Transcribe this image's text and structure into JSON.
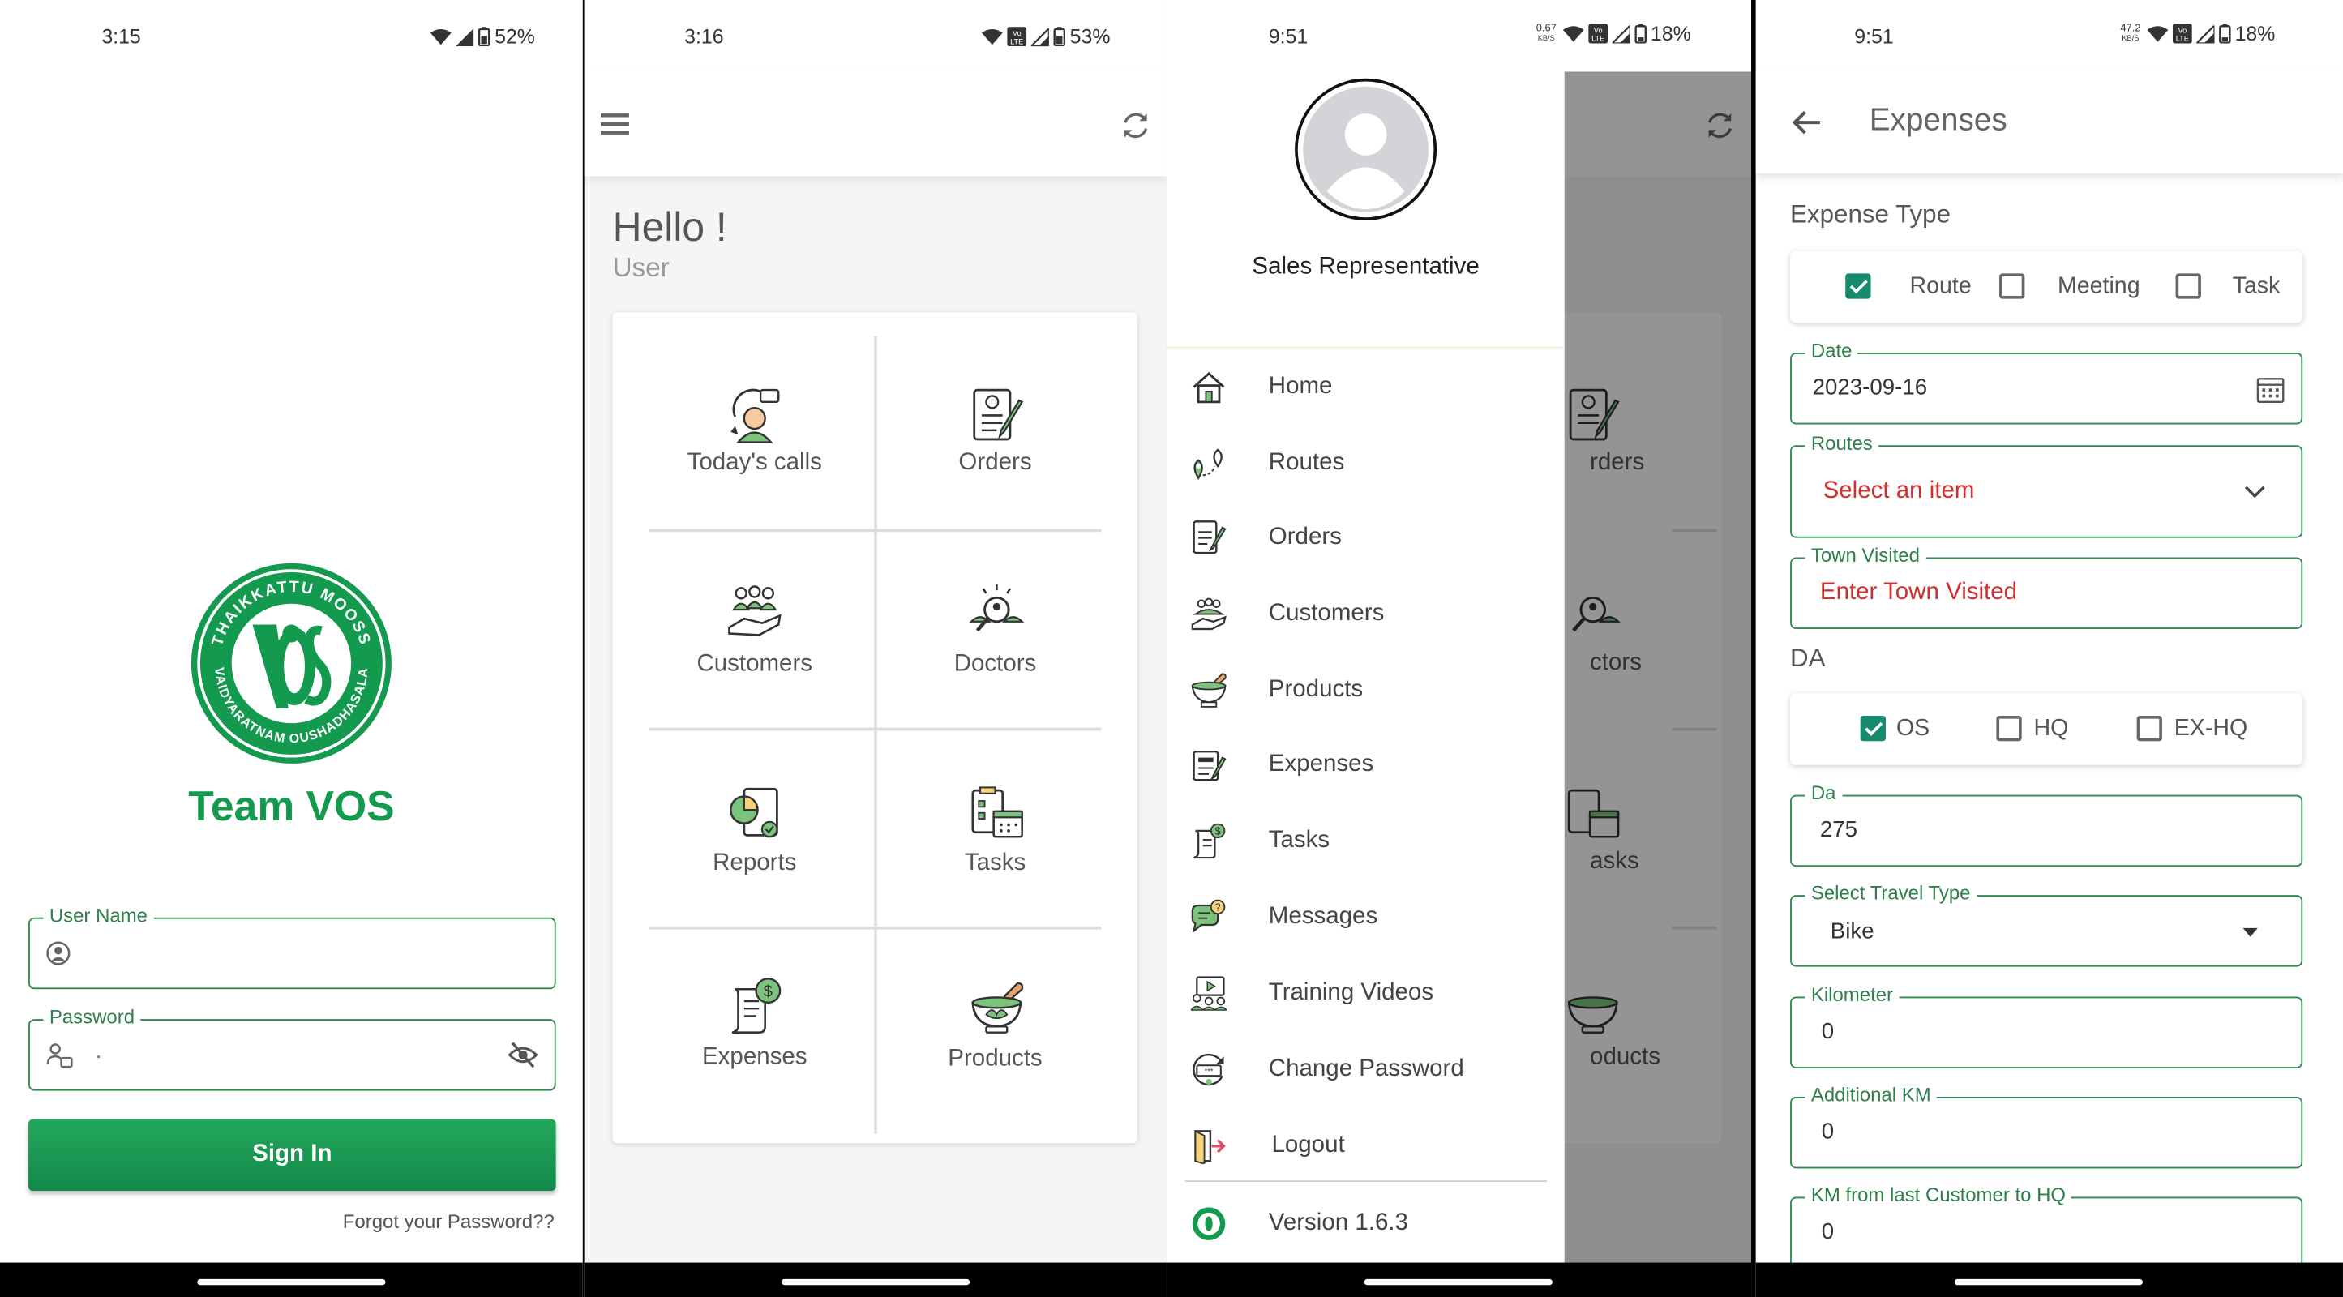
{
  "status": {
    "s1": {
      "time": "3:15",
      "battery": "52%"
    },
    "s2": {
      "time": "3:16",
      "battery": "53%"
    },
    "s3": {
      "time": "9:51",
      "speed": "0.67",
      "speed_unit": "KB/S",
      "battery": "18%"
    },
    "s4": {
      "time": "9:51",
      "speed": "47.2",
      "speed_unit": "KB/S",
      "battery": "18%"
    }
  },
  "login": {
    "logo_top_text": "THAIKKATTU MOOSS",
    "logo_bottom_text": "VAIDYARATNAM OUSHADHASALA",
    "logo_mark": "VOS",
    "app_name": "Team VOS",
    "username_label": "User Name",
    "password_label": "Password",
    "password_value": ".",
    "sign_in": "Sign In",
    "forgot": "Forgot your Password??"
  },
  "home": {
    "greeting": "Hello !",
    "user": "User",
    "tiles": [
      {
        "label": "Today's calls",
        "icon": "phone-call-icon"
      },
      {
        "label": "Orders",
        "icon": "order-document-icon"
      },
      {
        "label": "Customers",
        "icon": "customers-hand-icon"
      },
      {
        "label": "Doctors",
        "icon": "doctor-search-icon"
      },
      {
        "label": "Reports",
        "icon": "report-pie-icon"
      },
      {
        "label": "Tasks",
        "icon": "task-calendar-icon"
      },
      {
        "label": "Expenses",
        "icon": "expense-bill-icon"
      },
      {
        "label": "Products",
        "icon": "mortar-bowl-icon"
      }
    ]
  },
  "drawer": {
    "role": "Sales Representative",
    "items": [
      {
        "label": "Home",
        "icon": "home-icon"
      },
      {
        "label": "Routes",
        "icon": "route-pin-icon"
      },
      {
        "label": "Orders",
        "icon": "order-document-icon"
      },
      {
        "label": "Customers",
        "icon": "customers-hand-icon"
      },
      {
        "label": "Products",
        "icon": "mortar-bowl-icon"
      },
      {
        "label": "Expenses",
        "icon": "expense-bill-icon"
      },
      {
        "label": "Tasks",
        "icon": "task-dollar-icon"
      },
      {
        "label": "Messages",
        "icon": "message-icon"
      },
      {
        "label": "Training Videos",
        "icon": "video-training-icon"
      },
      {
        "label": "Change Password",
        "icon": "password-icon"
      },
      {
        "label": "Logout",
        "icon": "logout-icon"
      }
    ],
    "version": "Version 1.6.3",
    "bg_tiles": [
      "rders",
      "ctors",
      "asks",
      "oducts"
    ]
  },
  "expenses": {
    "title": "Expenses",
    "expense_type_heading": "Expense Type",
    "expense_types": [
      {
        "label": "Route",
        "checked": true
      },
      {
        "label": "Meeting",
        "checked": false
      },
      {
        "label": "Task",
        "checked": false
      }
    ],
    "date_label": "Date",
    "date_value": "2023-09-16",
    "routes_label": "Routes",
    "routes_placeholder": "Select an item",
    "town_label": "Town Visited",
    "town_placeholder": "Enter Town Visited",
    "da_heading": "DA",
    "da_types": [
      {
        "label": "OS",
        "checked": true
      },
      {
        "label": "HQ",
        "checked": false
      },
      {
        "label": "EX-HQ",
        "checked": false
      }
    ],
    "da_label": "Da",
    "da_value": "275",
    "travel_label": "Select Travel Type",
    "travel_value": "Bike",
    "km_label": "Kilometer",
    "km_value": "0",
    "add_km_label": "Additional KM",
    "add_km_value": "0",
    "last_km_label": "KM from last Customer to HQ",
    "last_km_value": "0"
  },
  "colors": {
    "brand_green": "#149a4f",
    "accent_teal": "#178a6e",
    "error_red": "#d32f2f"
  }
}
